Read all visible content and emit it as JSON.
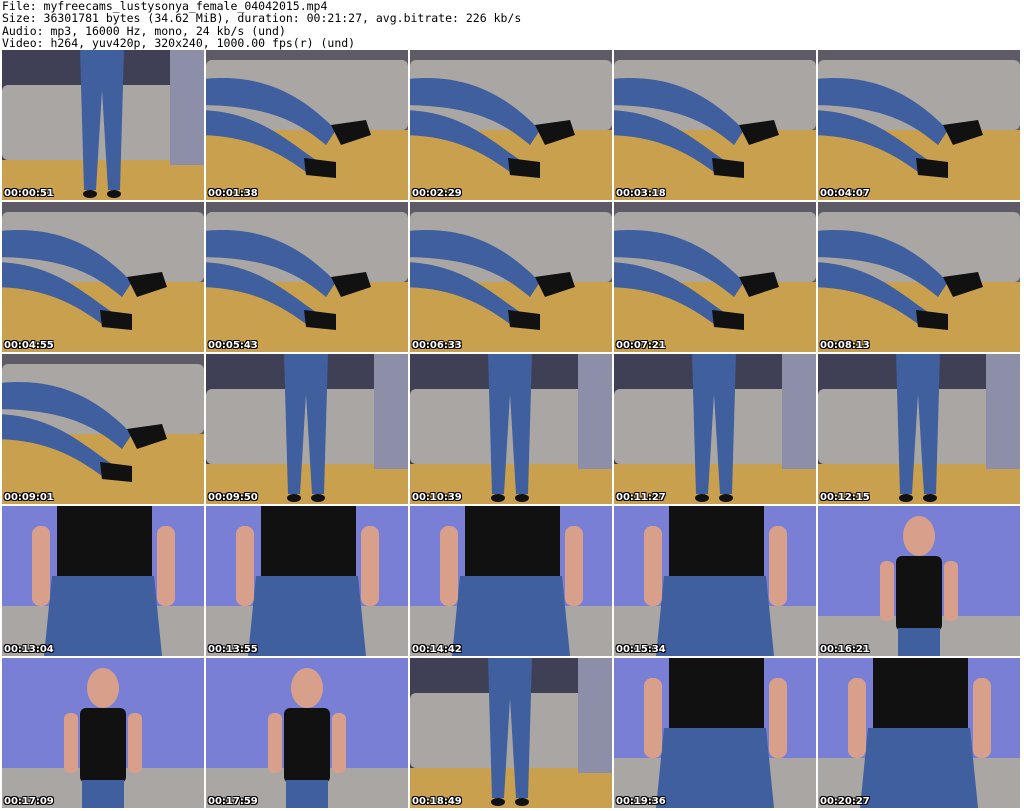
{
  "header": {
    "file": "File: myfreecams_lustysonya_female_04042015.mp4",
    "size": "Size: 36301781 bytes (34.62 MiB), duration: 00:21:27, avg.bitrate: 226 kb/s",
    "audio": "Audio: mp3, 16000 Hz, mono, 24 kb/s (und)",
    "video": "Video: h264, yuv420p, 320x240, 1000.00 fps(r) (und)"
  },
  "thumbnails": [
    {
      "time": "00:00:51",
      "scene": "standing"
    },
    {
      "time": "00:01:38",
      "scene": "legs-heels"
    },
    {
      "time": "00:02:29",
      "scene": "legs-heels"
    },
    {
      "time": "00:03:18",
      "scene": "legs-heels"
    },
    {
      "time": "00:04:07",
      "scene": "legs-heels"
    },
    {
      "time": "00:04:55",
      "scene": "legs-heels"
    },
    {
      "time": "00:05:43",
      "scene": "legs-heels"
    },
    {
      "time": "00:06:33",
      "scene": "legs-heels"
    },
    {
      "time": "00:07:21",
      "scene": "legs-heels"
    },
    {
      "time": "00:08:13",
      "scene": "legs-heels"
    },
    {
      "time": "00:09:01",
      "scene": "legs-heels"
    },
    {
      "time": "00:09:50",
      "scene": "standing"
    },
    {
      "time": "00:10:39",
      "scene": "standing"
    },
    {
      "time": "00:11:27",
      "scene": "standing"
    },
    {
      "time": "00:12:15",
      "scene": "standing"
    },
    {
      "time": "00:13:04",
      "scene": "torso"
    },
    {
      "time": "00:13:55",
      "scene": "torso"
    },
    {
      "time": "00:14:42",
      "scene": "torso"
    },
    {
      "time": "00:15:34",
      "scene": "torso"
    },
    {
      "time": "00:16:21",
      "scene": "portrait"
    },
    {
      "time": "00:17:09",
      "scene": "portrait"
    },
    {
      "time": "00:17:59",
      "scene": "portrait"
    },
    {
      "time": "00:18:49",
      "scene": "standing"
    },
    {
      "time": "00:19:36",
      "scene": "torso"
    },
    {
      "time": "00:20:27",
      "scene": "torso"
    }
  ],
  "colors": {
    "couch": "#a9a6a4",
    "floor": "#c9a04e",
    "wall": "#7a7fd6",
    "jeans": "#3f5f9e",
    "black": "#111111",
    "skin": "#d8a08a"
  }
}
